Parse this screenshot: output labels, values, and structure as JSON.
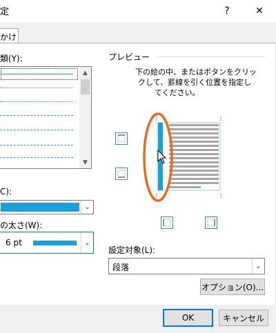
{
  "window": {
    "title_fragment": "定",
    "help_label": "?",
    "close_label": "✕"
  },
  "tab": {
    "label": "かけ"
  },
  "style_section": {
    "label": "類(Y):"
  },
  "color_section": {
    "label": "C):",
    "color": "#1a9fdc"
  },
  "width_section": {
    "label": "の太さ(W):",
    "value": "6 pt"
  },
  "preview": {
    "header": "プレビュー",
    "instructions": [
      "下の絵の中、またはボタンをクリッ",
      "クして、罫線を引く位置を指定し",
      "てください。"
    ]
  },
  "apply_to": {
    "label": "設定対象(L):",
    "value": "段落"
  },
  "buttons": {
    "options": "オプション(O)...",
    "ok": "OK",
    "cancel": "キャンセル"
  },
  "colors": {
    "accent": "#1a9fdc",
    "annotation": "#e86a1e",
    "focus": "#0078d7"
  },
  "icons": {
    "dropdown": "chevron-down-icon",
    "scroll_up": "scroll-up-icon",
    "scroll_down": "scroll-down-icon",
    "mouse_pointer": "mouse-pointer-icon"
  }
}
